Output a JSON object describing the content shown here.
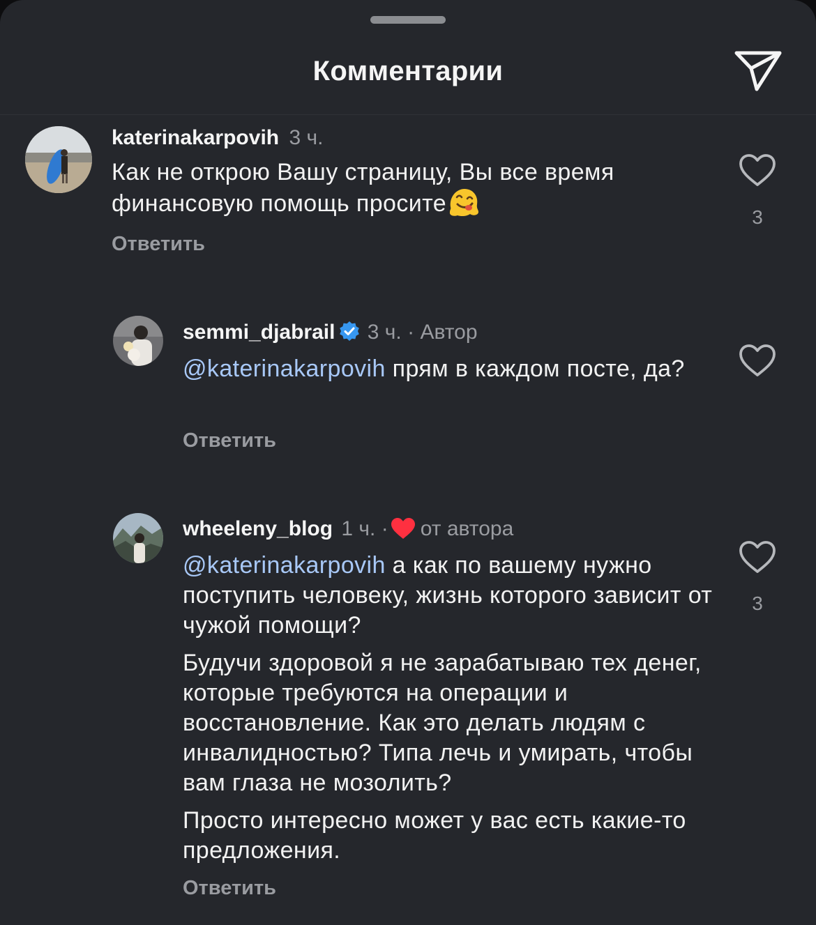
{
  "header": {
    "title": "Комментарии",
    "share_icon": "send-icon"
  },
  "comments": [
    {
      "username": "katerinakarpovih",
      "time": "3 ч.",
      "text_prefix": "Как не открою Вашу страницу, Вы все время финансовую помощь просите",
      "emoji": "melting-face",
      "reply_label": "Ответить",
      "likes": "3"
    },
    {
      "username": "semmi_djabrail",
      "verified": true,
      "time": "3 ч.",
      "separator": "·",
      "author_label": "Автор",
      "mention": "@katerinakarpovih",
      "text": " прям в каждом посте, да?",
      "reply_label": "Ответить"
    },
    {
      "username": "wheeleny_blog",
      "time": "1 ч.",
      "separator": "·",
      "liked_by": "от автора",
      "mention": "@katerinakarpovih",
      "paragraph1": " а как по вашему нужно поступить человеку, жизнь которого зависит от чужой помощи?",
      "paragraph2": "Будучи здоровой я не зарабатываю тех денег, которые требуются на операции и восстановление. Как это делать людям с инвалидностью? Типа лечь и умирать, чтобы вам глаза не мозолить?",
      "paragraph3": "Просто интересно может у вас есть какие-то предложения.",
      "reply_label": "Ответить",
      "likes": "3"
    }
  ],
  "colors": {
    "background": "#25272c",
    "mention": "#a8c8f7",
    "secondary_text": "#9a9ca1",
    "verified": "#3797f0",
    "heart": "#ff3040"
  }
}
